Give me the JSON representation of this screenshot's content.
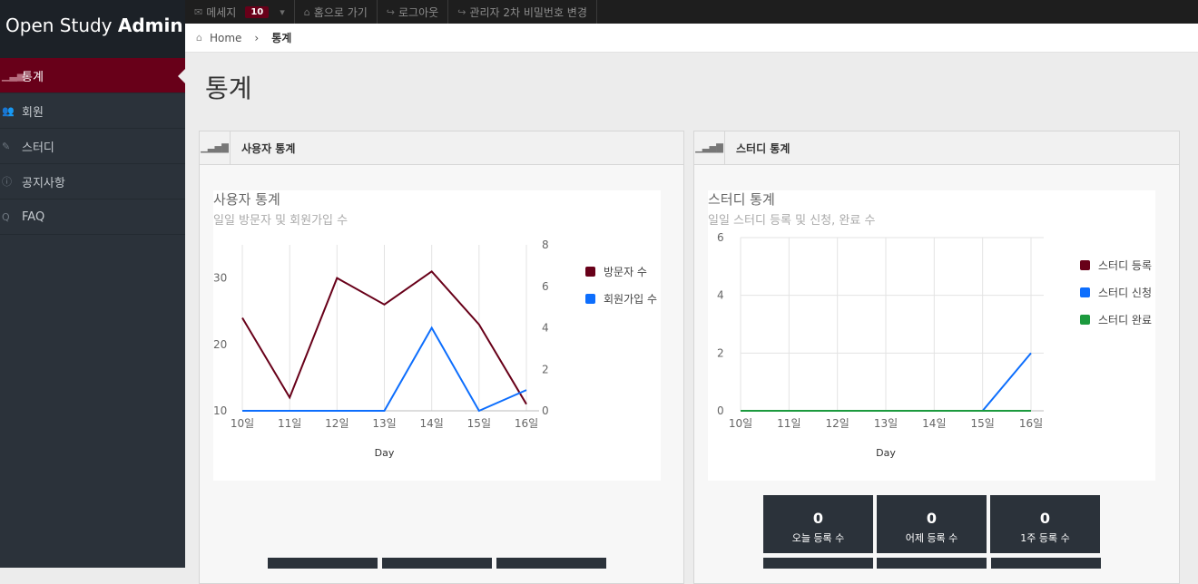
{
  "sidebar": {
    "brand_light": "Open Study ",
    "brand_bold": "Admin",
    "items": [
      {
        "label": "통계",
        "active": true,
        "icon": "bar-signal-icon"
      },
      {
        "label": "회원",
        "active": false,
        "icon": "users-icon"
      },
      {
        "label": "스터디",
        "active": false,
        "icon": "pencil-icon"
      },
      {
        "label": "공지사항",
        "active": false,
        "icon": "info-icon"
      },
      {
        "label": "FAQ",
        "active": false,
        "icon": "question-icon"
      }
    ]
  },
  "topbar": {
    "message_label": "메세지",
    "message_count": "10",
    "home_label": "홈으로 가기",
    "logout_label": "로그아웃",
    "password_label": "관리자 2차 비밀번호 변경"
  },
  "breadcrumb": {
    "home": "Home",
    "current": "통계"
  },
  "page_title": "통계",
  "panels": {
    "user": {
      "header": "사용자 통계"
    },
    "study": {
      "header": "스터디 통계"
    }
  },
  "colors": {
    "accent": "#680019",
    "blue": "#0d6efd",
    "green": "#1c9a3e",
    "sidebar": "#2b323a"
  },
  "chart_data": [
    {
      "type": "line",
      "title": "사용자 통계",
      "subtitle": "일일 방문자 및 회원가입 수",
      "xlabel": "Day",
      "categories": [
        "10일",
        "11일",
        "12일",
        "13일",
        "14일",
        "15일",
        "16일"
      ],
      "left_axis": {
        "ylim": [
          10,
          35
        ],
        "ticks": [
          10,
          20,
          30
        ]
      },
      "right_axis": {
        "ylim": [
          0,
          8
        ],
        "ticks": [
          0,
          2,
          4,
          6,
          8
        ]
      },
      "series": [
        {
          "name": "방문자 수",
          "axis": "left",
          "color": "#680019",
          "values": [
            24,
            12,
            30,
            26,
            31,
            23,
            11
          ]
        },
        {
          "name": "회원가입 수",
          "axis": "right",
          "color": "#0d6efd",
          "values": [
            0,
            0,
            0,
            0,
            4,
            0,
            1
          ]
        }
      ],
      "legend": "right",
      "grid": true
    },
    {
      "type": "line",
      "title": "스터디 통계",
      "subtitle": "일일 스터디 등록 및 신청, 완료 수",
      "xlabel": "Day",
      "categories": [
        "10일",
        "11일",
        "12일",
        "13일",
        "14일",
        "15일",
        "16일"
      ],
      "ylim": [
        0,
        6
      ],
      "yticks": [
        0,
        2,
        4,
        6
      ],
      "series": [
        {
          "name": "스터디 등록",
          "color": "#680019",
          "values": [
            0,
            0,
            0,
            0,
            0,
            0,
            0
          ]
        },
        {
          "name": "스터디 신청",
          "color": "#0d6efd",
          "values": [
            0,
            0,
            0,
            0,
            0,
            0,
            2
          ]
        },
        {
          "name": "스터디 완료",
          "color": "#1c9a3e",
          "values": [
            0,
            0,
            0,
            0,
            0,
            0,
            0
          ]
        }
      ],
      "legend": "right",
      "grid": true
    }
  ],
  "study_stats": [
    {
      "value": "0",
      "label": "오늘 등록 수"
    },
    {
      "value": "0",
      "label": "어제 등록 수"
    },
    {
      "value": "0",
      "label": "1주 등록 수"
    }
  ]
}
